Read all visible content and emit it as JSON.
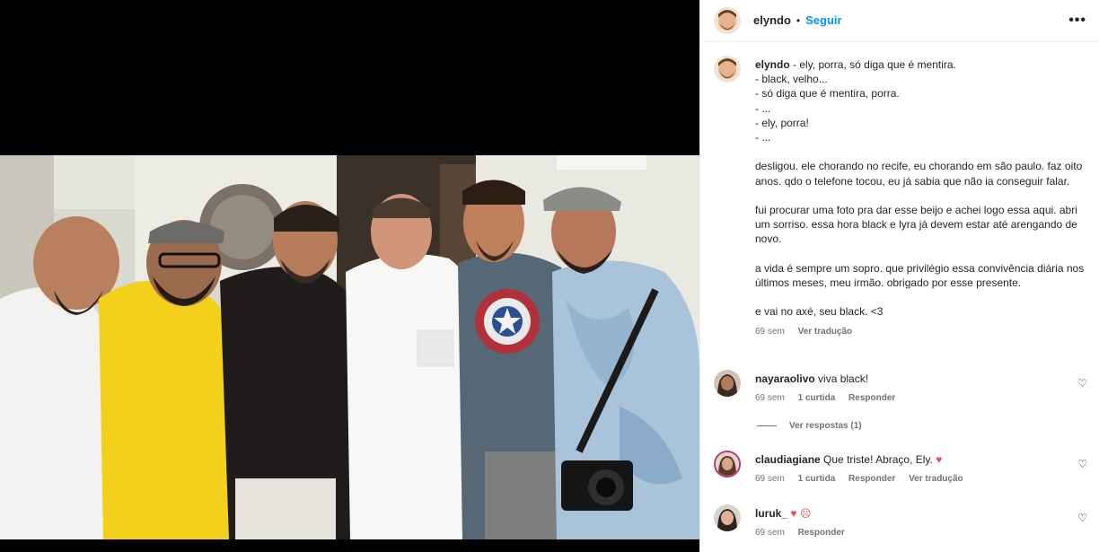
{
  "post": {
    "username": "elyndo",
    "separator": "•",
    "follow_label": "Seguir",
    "more_label": "•••"
  },
  "caption": {
    "username": "elyndo",
    "lines": [
      "- ely, porra, só diga que é mentira.",
      "- black, velho...",
      "- só diga que é mentira, porra.",
      "- ...",
      "- ely, porra!",
      "- ...",
      "",
      "desligou. ele chorando no recife, eu chorando em são paulo. faz oito anos. qdo o telefone tocou, eu já sabia que não ia conseguir falar.",
      "",
      "fui procurar uma foto pra dar esse beijo e achei logo essa aqui. abri um sorriso. essa hora black e lyra já devem estar até arengando de novo.",
      "",
      "a vida é sempre um sopro. que privilégio essa convivência diária nos últimos meses, meu irmão. obrigado por esse presente.",
      "",
      "e vai no axé, seu black. <3"
    ],
    "time": "69 sem",
    "translate": "Ver tradução"
  },
  "comments": [
    {
      "username": "nayaraolivo",
      "text": "viva black!",
      "time": "69 sem",
      "likes": "1 curtida",
      "reply": "Responder",
      "translate": ""
    },
    {
      "username": "claudiagiane",
      "text": "Que triste! Abraço, Ely.",
      "emoji": "♥",
      "time": "69 sem",
      "likes": "1 curtida",
      "reply": "Responder",
      "translate": "Ver tradução"
    },
    {
      "username": "luruk_",
      "text": "",
      "emoji": "♥ ☹",
      "time": "69 sem",
      "likes": "",
      "reply": "Responder",
      "translate": ""
    }
  ],
  "view_replies": "Ver respostas (1)",
  "colors": {
    "accent": "#0095f6",
    "heart": "#ed4956",
    "muted": "#737373"
  }
}
